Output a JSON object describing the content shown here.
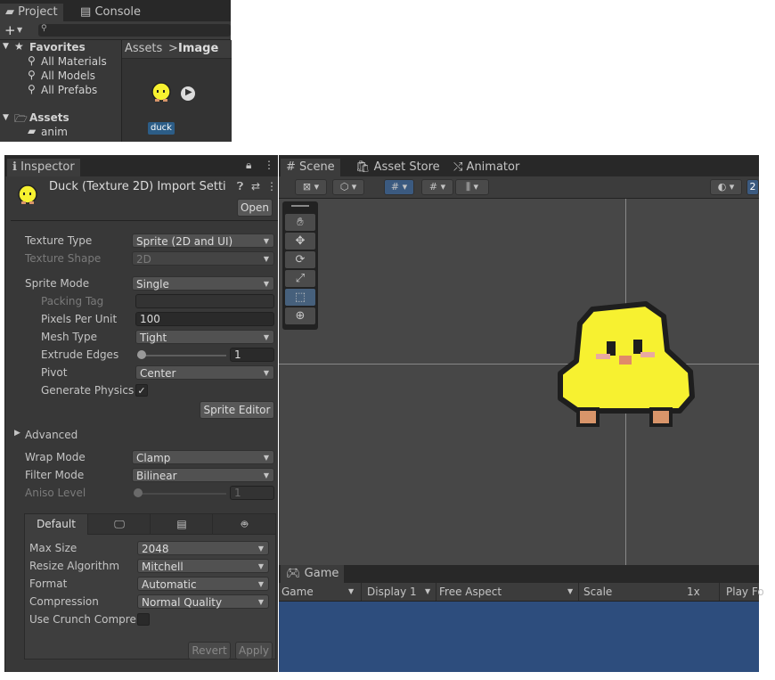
{
  "project": {
    "tabs": [
      {
        "label": "Project",
        "icon": "folder-icon"
      },
      {
        "label": "Console",
        "icon": "console-icon"
      }
    ],
    "add_label": "+",
    "favorites": {
      "label": "Favorites",
      "items": [
        "All Materials",
        "All Models",
        "All Prefabs"
      ]
    },
    "assets": {
      "label": "Assets",
      "items": [
        "anim"
      ]
    },
    "breadcrumb": {
      "root": "Assets",
      "separator": ">",
      "current": "Image"
    },
    "asset_item": {
      "name": "duck"
    }
  },
  "inspector": {
    "tab_label": "Inspector",
    "title": "Duck (Texture 2D) Import Setti",
    "open_label": "Open",
    "rows": {
      "texture_type": {
        "label": "Texture Type",
        "value": "Sprite (2D and UI)"
      },
      "texture_shape": {
        "label": "Texture Shape",
        "value": "2D"
      },
      "sprite_mode": {
        "label": "Sprite Mode",
        "value": "Single"
      },
      "packing_tag": {
        "label": "Packing Tag",
        "value": ""
      },
      "pixels_per_unit": {
        "label": "Pixels Per Unit",
        "value": "100"
      },
      "mesh_type": {
        "label": "Mesh Type",
        "value": "Tight"
      },
      "extrude_edges": {
        "label": "Extrude Edges",
        "value": "1"
      },
      "pivot": {
        "label": "Pivot",
        "value": "Center"
      },
      "generate_physics": {
        "label": "Generate Physics",
        "checked": "✓"
      },
      "advanced": {
        "label": "Advanced"
      },
      "wrap_mode": {
        "label": "Wrap Mode",
        "value": "Clamp"
      },
      "filter_mode": {
        "label": "Filter Mode",
        "value": "Bilinear"
      },
      "aniso_level": {
        "label": "Aniso Level",
        "value": "1"
      }
    },
    "sprite_editor_label": "Sprite Editor",
    "platform_tabs": {
      "default": "Default"
    },
    "platform": {
      "max_size": {
        "label": "Max Size",
        "value": "2048"
      },
      "resize_algorithm": {
        "label": "Resize Algorithm",
        "value": "Mitchell"
      },
      "format": {
        "label": "Format",
        "value": "Automatic"
      },
      "compression": {
        "label": "Compression",
        "value": "Normal Quality"
      },
      "use_crunch": {
        "label": "Use Crunch Compres"
      }
    },
    "revert_label": "Revert",
    "apply_label": "Apply"
  },
  "scene": {
    "tabs": [
      {
        "label": "Scene",
        "icon": "grid-icon"
      },
      {
        "label": "Asset Store",
        "icon": "store-icon"
      },
      {
        "label": "Animator",
        "icon": "animator-icon"
      }
    ],
    "toolbar_right_label": "2"
  },
  "game": {
    "tab_label": "Game",
    "toolbar": {
      "display_mode": "Game",
      "display": "Display 1",
      "aspect": "Free Aspect",
      "scale_label": "Scale",
      "scale_value": "1x",
      "play_label": "Play Fo"
    }
  },
  "colors": {
    "duck_yellow": "#f7f130",
    "accent_blue": "#3b5a80",
    "game_bg": "#2d4d7d"
  }
}
